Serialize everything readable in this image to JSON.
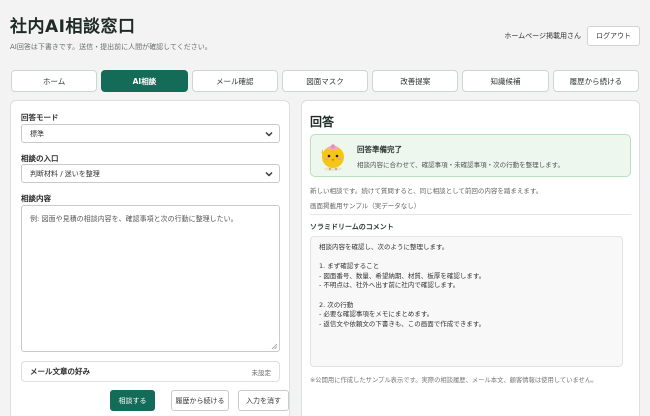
{
  "header": {
    "title": "社内AI相談窓口",
    "subtitle": "AI回答は下書きです。送信・提出前に人間が確認してください。",
    "user_name": "ホームページ掲載用さん",
    "logout_label": "ログアウト"
  },
  "tabs": [
    {
      "label": "ホーム",
      "active": false
    },
    {
      "label": "AI相談",
      "active": true
    },
    {
      "label": "メール確認",
      "active": false
    },
    {
      "label": "図面マスク",
      "active": false
    },
    {
      "label": "改善提案",
      "active": false
    },
    {
      "label": "知識候補",
      "active": false
    },
    {
      "label": "履歴から続ける",
      "active": false
    }
  ],
  "form": {
    "mode_label": "回答モード",
    "mode_value": "標準",
    "entry_label": "相談の入口",
    "entry_value": "判断材料 / 迷いを整理",
    "content_label": "相談内容",
    "content_placeholder": "例: 図面や見積の相談内容を、確認事項と次の行動に整理したい。",
    "pref_label": "メール文章の好み",
    "pref_value": "未設定",
    "submit_label": "相談する",
    "history_label": "履歴から続ける",
    "clear_label": "入力を消す"
  },
  "answer": {
    "title": "回答",
    "status_title": "回答準備完了",
    "status_desc": "相談内容に合わせて、確認事項・未確認事項・次の行動を整理します。",
    "new_note": "新しい相談です。続けて質問すると、同じ相談として前回の内容を踏まえます。",
    "sample_note": "画面掲載用サンプル（実データなし）",
    "comment_heading": "ソラミドリームのコメント",
    "comment_lines": [
      "相談内容を確認し、次のように整理します。",
      "",
      "1. まず確認すること",
      "- 図面番号、数量、希望納期、材質、板厚を確認します。",
      "- 不明点は、社外へ出す前に社内で確認します。",
      "",
      "2. 次の行動",
      "- 必要な確認事項をメモにまとめます。",
      "- 返信文や依頼文の下書きも、この画面で作成できます。"
    ],
    "footnote": "※公開用に作成したサンプル表示です。実際の相談履歴、メール本文、顧客情報は使用していません。"
  },
  "colors": {
    "accent": "#146b58",
    "status_bg": "#edf7ee",
    "mascot": "#f5c518"
  },
  "icons": {
    "select_chevron": "chevron-down-icon",
    "mascot": "chick-mascot-icon"
  }
}
